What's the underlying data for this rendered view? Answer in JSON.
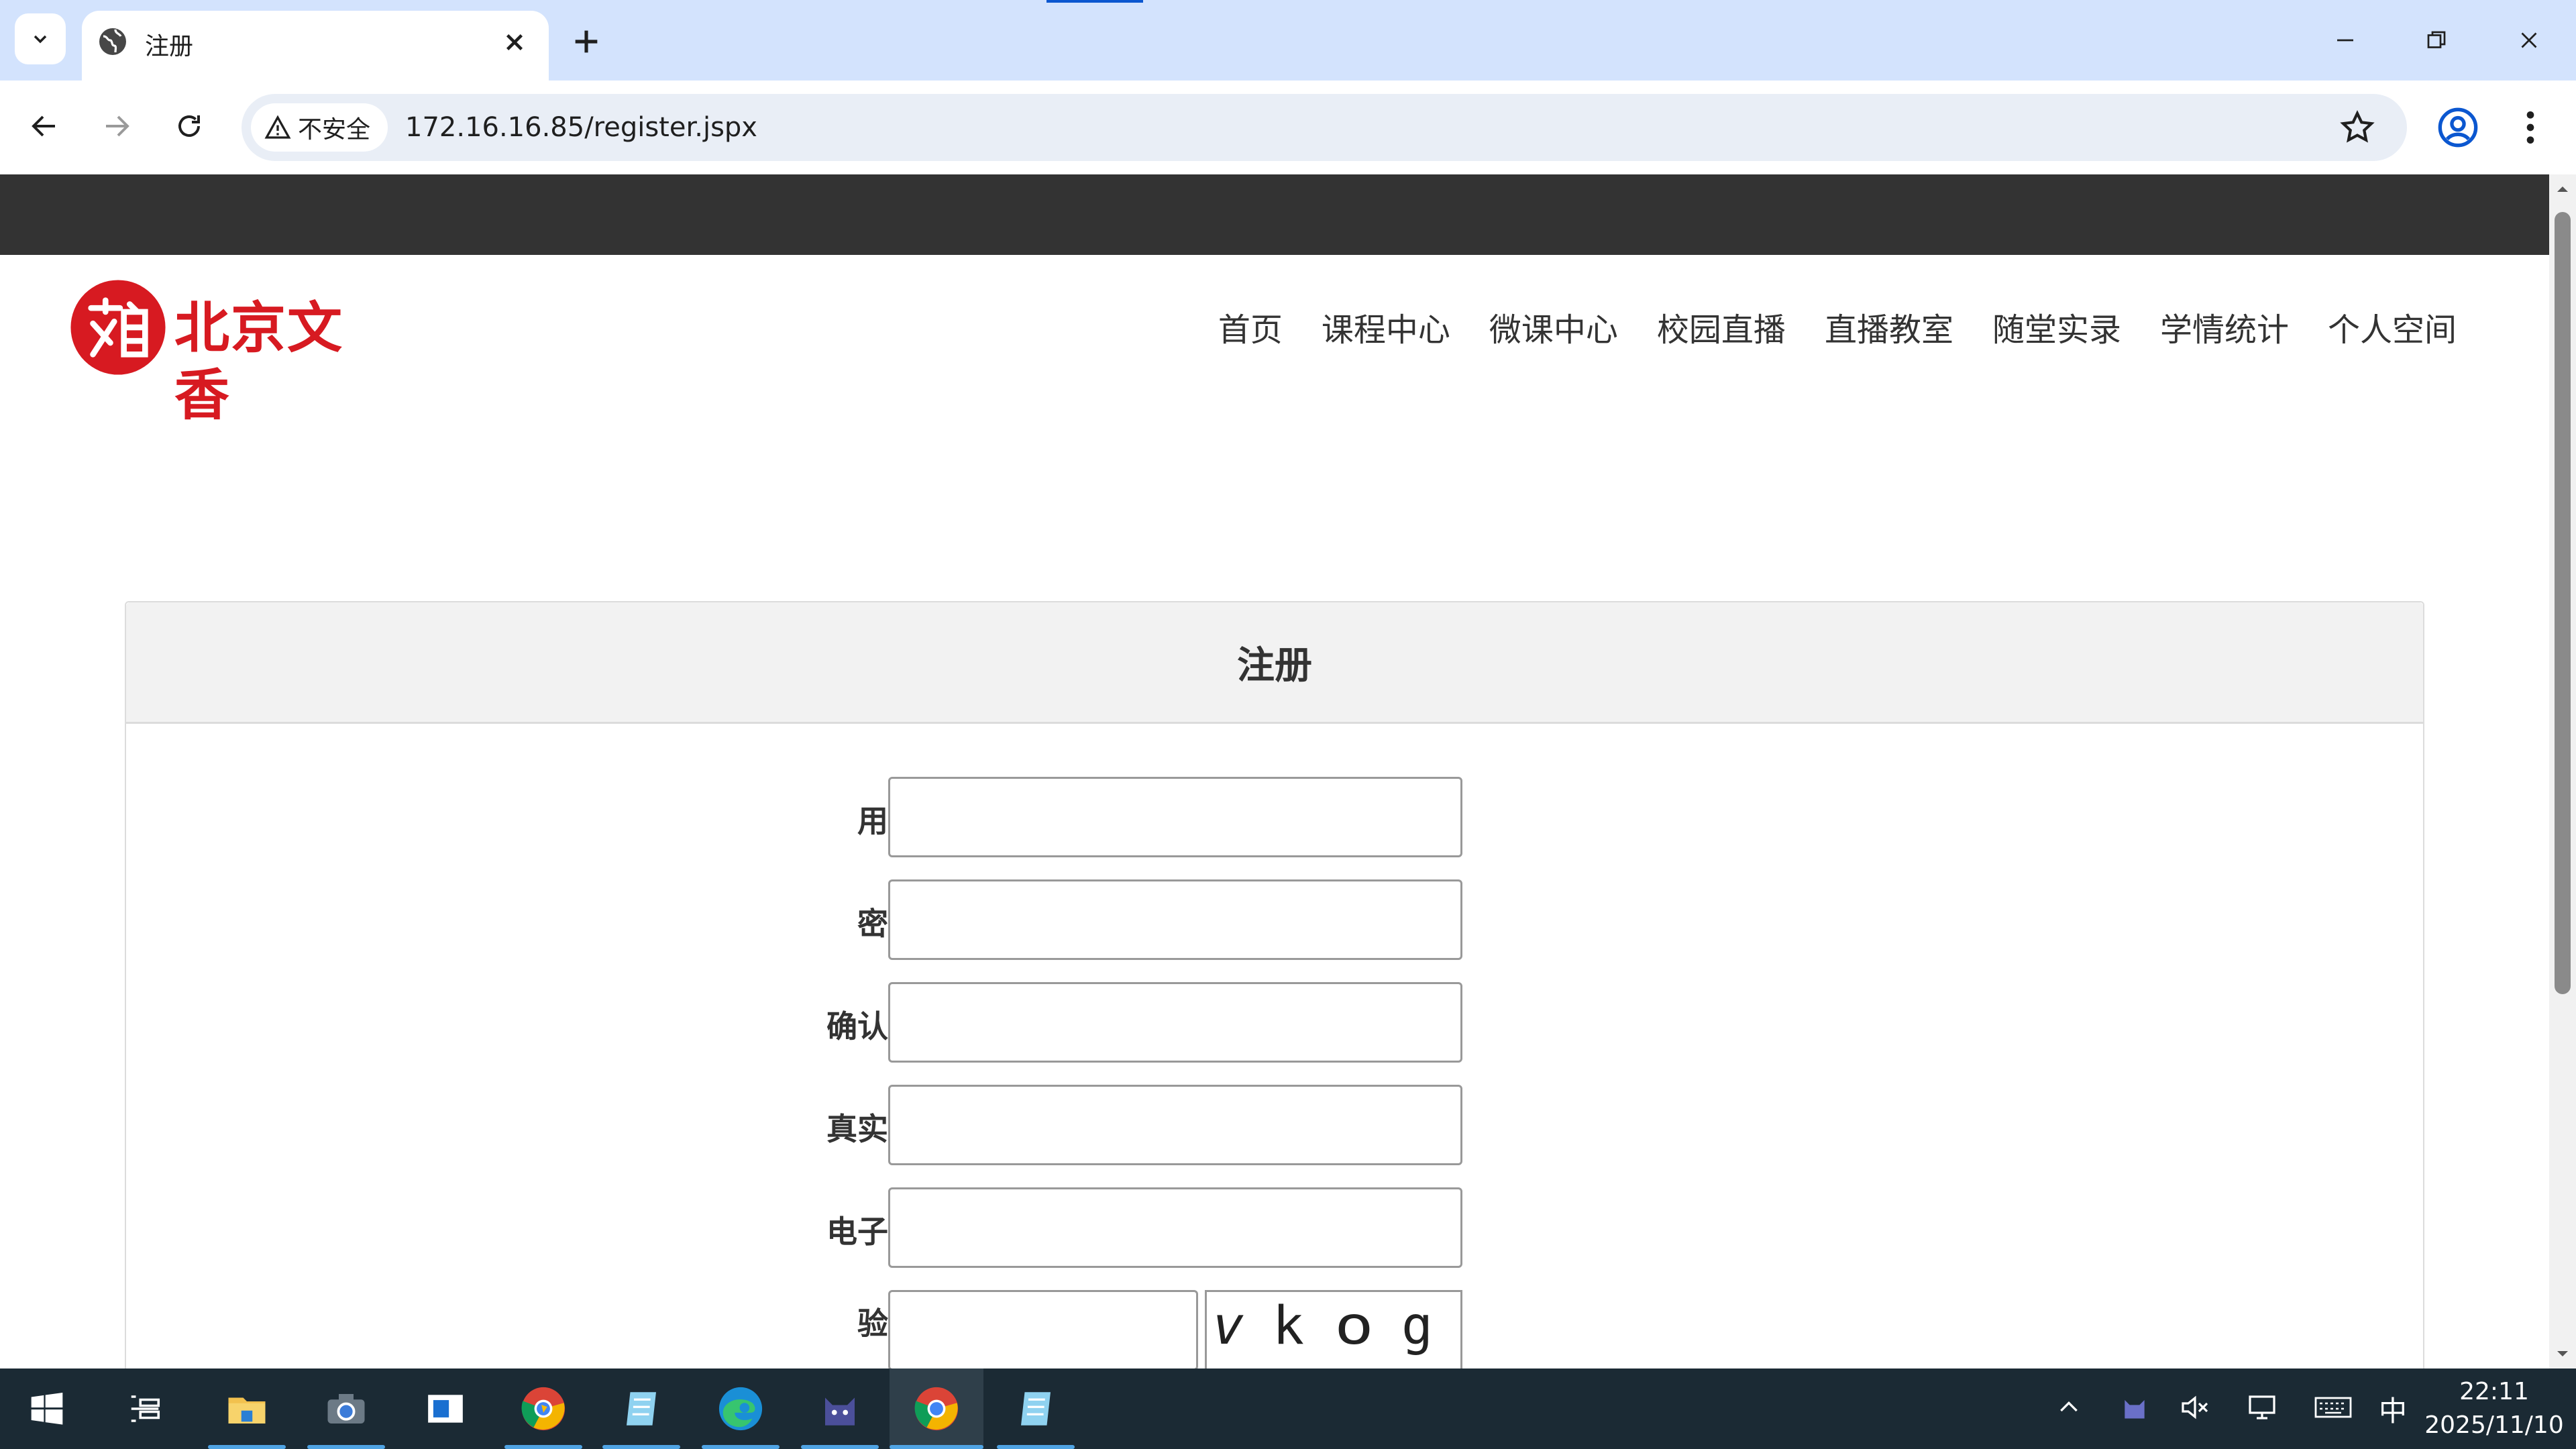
{
  "browser": {
    "tab_title": "注册",
    "security_text": "不安全",
    "url": "172.16.16.85/register.jspx"
  },
  "site": {
    "logo_text": "北京文香",
    "nav": [
      "首页",
      "课程中心",
      "微课中心",
      "校园直播",
      "直播教室",
      "随堂实录",
      "学情统计",
      "个人空间"
    ]
  },
  "form": {
    "title": "注册",
    "fields": [
      {
        "label": "用户名：",
        "value": ""
      },
      {
        "label": "密　码：",
        "value": ""
      },
      {
        "label": "确认密码：",
        "value": ""
      },
      {
        "label": "真实姓名：",
        "value": ""
      },
      {
        "label": "电子邮箱：",
        "value": ""
      },
      {
        "label": "验证码：",
        "value": ""
      }
    ],
    "captcha_chars": [
      "v",
      "k",
      "o",
      "g"
    ]
  },
  "taskbar": {
    "ime": "中",
    "time": "22:11",
    "date": "2025/11/10"
  },
  "colors": {
    "brand_red": "#d71a21",
    "topbar": "#333333",
    "tabstrip": "#d3e3fd",
    "taskbar": "#1b2a34"
  }
}
